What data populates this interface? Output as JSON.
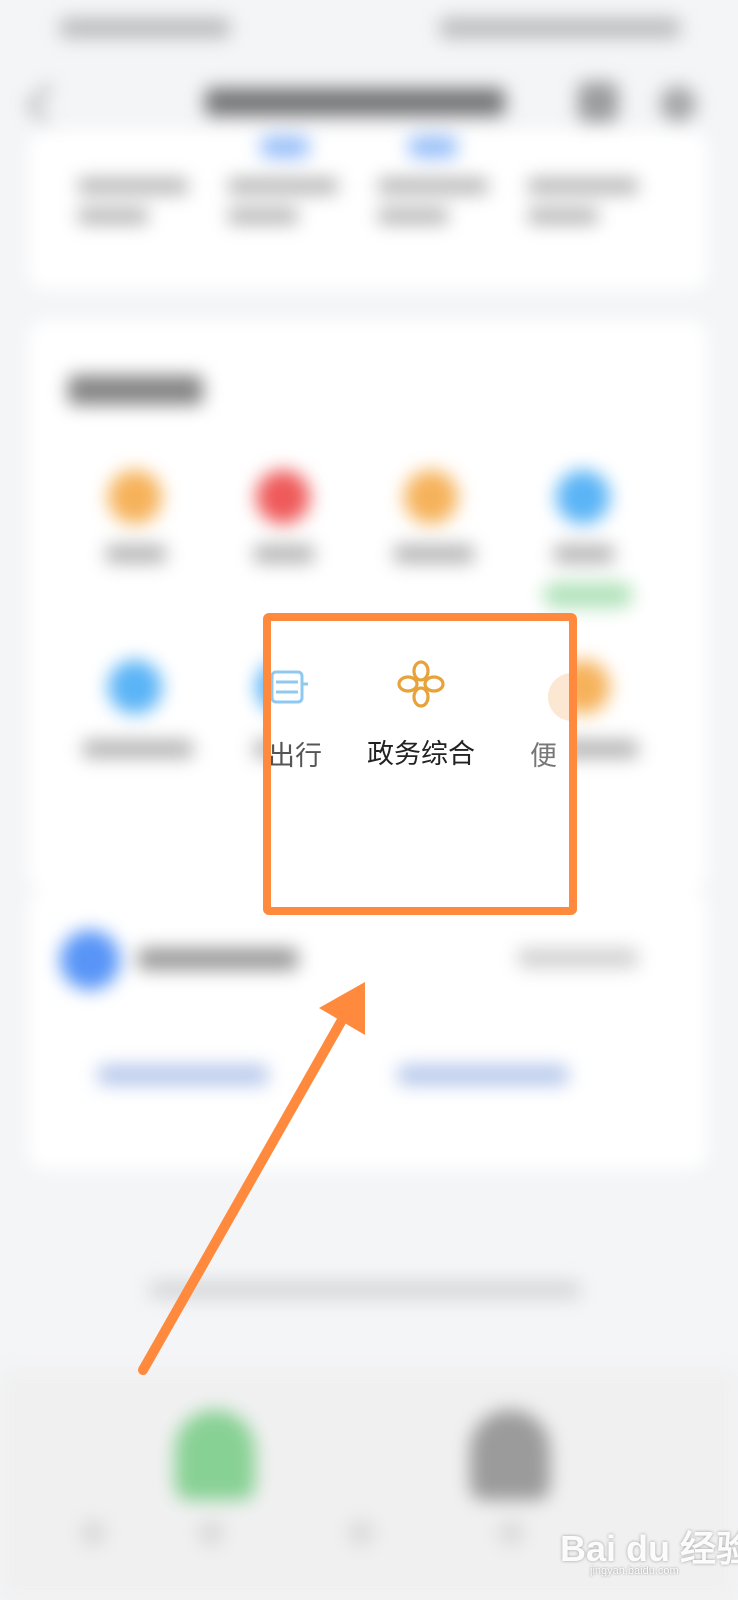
{
  "focus": {
    "center_item_label": "政务综合",
    "left_fragment_label": "出行",
    "right_fragment_label": "便",
    "icon_color": "#e8a23a"
  },
  "annotation": {
    "highlight_color": "#ff8a3d",
    "arrow_color": "#ff8a3d"
  },
  "watermark": {
    "text": "Bai du 经验",
    "sub": "jingyan.baidu.com"
  }
}
